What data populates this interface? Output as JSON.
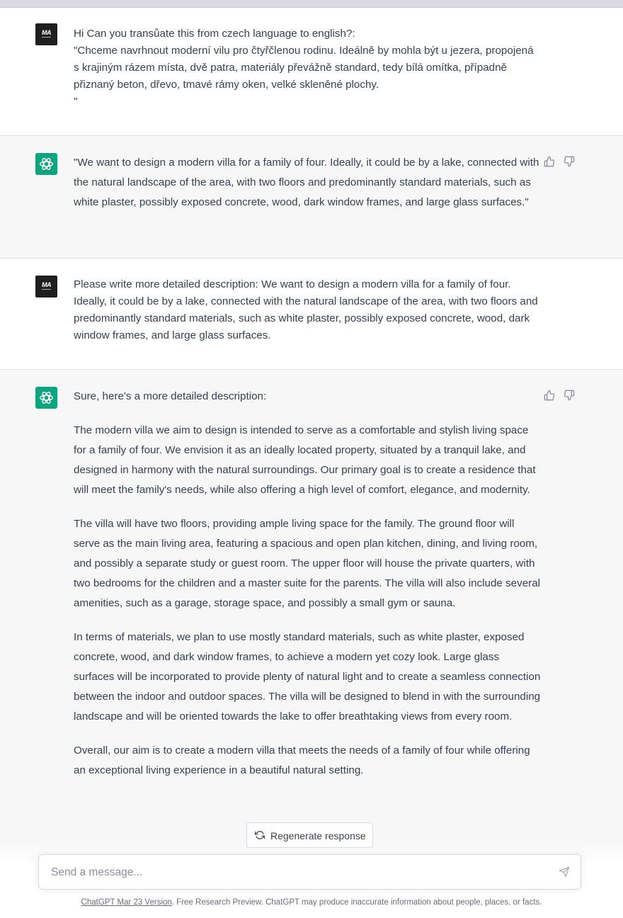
{
  "messages": [
    {
      "role": "user",
      "lines": [
        "Hi Can you transůate this from czech language to english?:",
        "\"Chceme navrhnout moderní vilu pro čtyřčlenou rodinu. Ideálně by mohla být u jezera, propojená s krajiným rázem místa, dvě patra, materiály převážně standard, tedy bílá omítka, případně přiznaný beton, dřevo, tmavé rámy oken, velké skleněné plochy.",
        "\""
      ]
    },
    {
      "role": "assistant",
      "paragraphs": [
        "\"We want to design a modern villa for a family of four. Ideally, it could be by a lake, connected with the natural landscape of the area, with two floors and predominantly standard materials, such as white plaster, possibly exposed concrete, wood, dark window frames, and large glass surfaces.\""
      ]
    },
    {
      "role": "user",
      "lines": [
        "Please write more detailed description: We want to design a modern villa for a family of four. Ideally, it could be by a lake, connected with the natural landscape of the area, with two floors and predominantly standard materials, such as white plaster, possibly exposed concrete, wood, dark window frames, and large glass surfaces."
      ]
    },
    {
      "role": "assistant",
      "paragraphs": [
        "Sure, here's a more detailed description:",
        "The modern villa we aim to design is intended to serve as a comfortable and stylish living space for a family of four. We envision it as an ideally located property, situated by a tranquil lake, and designed in harmony with the natural surroundings. Our primary goal is to create a residence that will meet the family's needs, while also offering a high level of comfort, elegance, and modernity.",
        "The villa will have two floors, providing ample living space for the family. The ground floor will serve as the main living area, featuring a spacious and open plan kitchen, dining, and living room, and possibly a separate study or guest room. The upper floor will house the private quarters, with two bedrooms for the children and a master suite for the parents. The villa will also include several amenities, such as a garage, storage space, and possibly a small gym or sauna.",
        "In terms of materials, we plan to use mostly standard materials, such as white plaster, exposed concrete, wood, and dark window frames, to achieve a modern yet cozy look. Large glass surfaces will be incorporated to provide plenty of natural light and to create a seamless connection between the indoor and outdoor spaces. The villa will be designed to blend in with the surrounding landscape and will be oriented towards the lake to offer breathtaking views from every room.",
        "Overall, our aim is to create a modern villa that meets the needs of a family of four while offering an exceptional living experience in a beautiful natural setting."
      ]
    }
  ],
  "user_avatar_text": "MA",
  "regenerate_label": "Regenerate response",
  "input": {
    "placeholder": "Send a message...",
    "value": ""
  },
  "footer": {
    "link_text": "ChatGPT Mar 23 Version",
    "text": ". Free Research Preview. ChatGPT may produce inaccurate information about people, places, or facts."
  },
  "icons": {
    "user_avatar": "ma-logo-icon",
    "assistant_avatar": "openai-logo-icon",
    "like": "thumbs-up-icon",
    "dislike": "thumbs-down-icon",
    "regenerate": "refresh-icon",
    "send": "send-icon"
  },
  "colors": {
    "assistant_avatar_bg": "#10a37f",
    "assistant_row_bg": "#f7f7f8",
    "user_avatar_bg": "#1f1f1f"
  }
}
